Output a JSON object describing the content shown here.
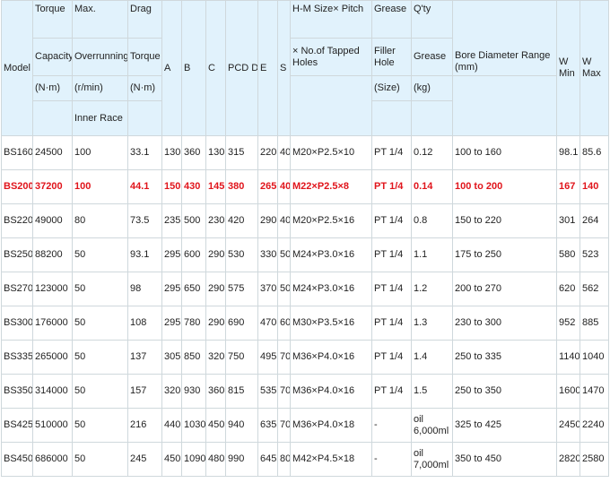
{
  "header": {
    "model": "Model",
    "torque_1": "Torque",
    "torque_2": "Capacity",
    "torque_3": "(N·m)",
    "max_1": "Max.",
    "max_2": "Overrunning",
    "max_3": "(r/min)",
    "max_4": "Inner Race",
    "drag_1": "Drag",
    "drag_2": "Torque",
    "drag_3": "(N·m)",
    "a": "A",
    "b": "B",
    "c": "C",
    "pcd": "PCD D",
    "e": "E",
    "s": "S",
    "hm_1": "H-M Size× Pitch",
    "hm_2": "× No.of Tapped Holes",
    "grease_1": "Grease",
    "grease_2": "Filler Hole",
    "grease_3": "(Size)",
    "qty_1": "Q'ty",
    "qty_2": "Grease",
    "qty_3": "(kg)",
    "bore_1": "Bore Diameter Range",
    "bore_2": "(mm)",
    "wmin": "W Min",
    "wmax": "W Max"
  },
  "rows": [
    {
      "model": "BS160",
      "torque": "24500",
      "max": "100",
      "drag": "33.1",
      "a": "130",
      "b": "360",
      "c": "130",
      "pcd": "315",
      "e": "220",
      "s": "40",
      "hm": "M20×P2.5×10",
      "filler": "PT 1/4",
      "qty": "0.12",
      "bore": "100 to 160",
      "wmin": "98.1",
      "wmax": "85.6"
    },
    {
      "model": "BS200",
      "torque": "37200",
      "max": "100",
      "drag": "44.1",
      "a": "150",
      "b": "430",
      "c": "145",
      "pcd": "380",
      "e": "265",
      "s": "40",
      "hm": "M22×P2.5×8",
      "filler": "PT 1/4",
      "qty": "0.14",
      "bore": "100 to 200",
      "wmin": "167",
      "wmax": "140"
    },
    {
      "model": "BS220",
      "torque": "49000",
      "max": "80",
      "drag": "73.5",
      "a": "235",
      "b": "500",
      "c": "230",
      "pcd": "420",
      "e": "290",
      "s": "40",
      "hm": "M20×P2.5×16",
      "filler": "PT 1/4",
      "qty": "0.8",
      "bore": "150 to 220",
      "wmin": "301",
      "wmax": "264"
    },
    {
      "model": "BS250",
      "torque": "88200",
      "max": "50",
      "drag": "93.1",
      "a": "295",
      "b": "600",
      "c": "290",
      "pcd": "530",
      "e": "330",
      "s": "50",
      "hm": "M24×P3.0×16",
      "filler": "PT 1/4",
      "qty": "1.1",
      "bore": "175 to 250",
      "wmin": "580",
      "wmax": "523"
    },
    {
      "model": "BS270",
      "torque": "123000",
      "max": "50",
      "drag": "98",
      "a": "295",
      "b": "650",
      "c": "290",
      "pcd": "575",
      "e": "370",
      "s": "50",
      "hm": "M24×P3.0×16",
      "filler": "PT 1/4",
      "qty": "1.2",
      "bore": "200 to 270",
      "wmin": "620",
      "wmax": "562"
    },
    {
      "model": "BS300",
      "torque": "176000",
      "max": "50",
      "drag": "108",
      "a": "295",
      "b": "780",
      "c": "290",
      "pcd": "690",
      "e": "470",
      "s": "60",
      "hm": "M30×P3.5×16",
      "filler": "PT 1/4",
      "qty": "1.3",
      "bore": "230 to 300",
      "wmin": "952",
      "wmax": "885"
    },
    {
      "model": "BS335",
      "torque": "265000",
      "max": "50",
      "drag": "137",
      "a": "305",
      "b": "850",
      "c": "320",
      "pcd": "750",
      "e": "495",
      "s": "70",
      "hm": "M36×P4.0×16",
      "filler": "PT 1/4",
      "qty": "1.4",
      "bore": "250 to 335",
      "wmin": "1140",
      "wmax": "1040"
    },
    {
      "model": "BS350",
      "torque": "314000",
      "max": "50",
      "drag": "157",
      "a": "320",
      "b": "930",
      "c": "360",
      "pcd": "815",
      "e": "535",
      "s": "70",
      "hm": "M36×P4.0×16",
      "filler": "PT 1/4",
      "qty": "1.5",
      "bore": "250 to 350",
      "wmin": "1600",
      "wmax": "1470"
    },
    {
      "model": "BS425",
      "torque": "510000",
      "max": "50",
      "drag": "216",
      "a": "440",
      "b": "1030",
      "c": "450",
      "pcd": "940",
      "e": "635",
      "s": "70",
      "hm": "M36×P4.0×18",
      "filler": "-",
      "qty": "oil 6,000ml",
      "bore": "325 to 425",
      "wmin": "2450",
      "wmax": "2240"
    },
    {
      "model": "BS450",
      "torque": "686000",
      "max": "50",
      "drag": "245",
      "a": "450",
      "b": "1090",
      "c": "480",
      "pcd": "990",
      "e": "645",
      "s": "80",
      "hm": "M42×P4.5×18",
      "filler": "-",
      "qty": "oil 7,000ml",
      "bore": "350 to 450",
      "wmin": "2820",
      "wmax": "2580"
    }
  ],
  "highlight_row": "BS200",
  "colors": {
    "header_bg": "#e1f2fc",
    "border": "#cfd8dc",
    "highlight_text": "#e0141b",
    "text": "#222222"
  }
}
